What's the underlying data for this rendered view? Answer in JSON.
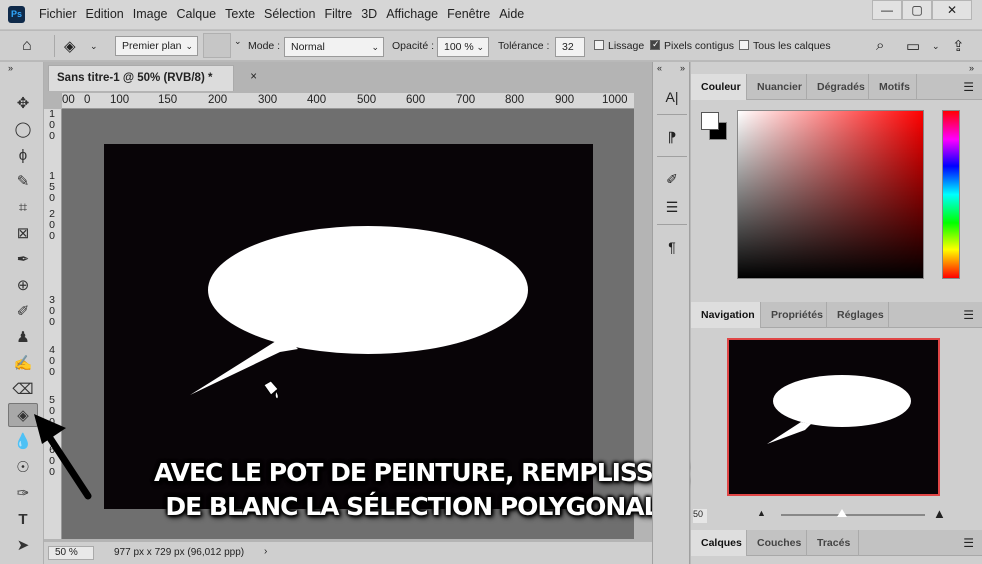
{
  "app": {
    "logo_text": "Ps"
  },
  "menu": [
    "Fichier",
    "Edition",
    "Image",
    "Calque",
    "Texte",
    "Sélection",
    "Filtre",
    "3D",
    "Affichage",
    "Fenêtre",
    "Aide"
  ],
  "window_controls": [
    "—",
    "▢",
    "✕"
  ],
  "options": {
    "fill_source": "Premier plan",
    "mode_label": "Mode :",
    "mode_value": "Normal",
    "opacity_label": "Opacité :",
    "opacity_value": "100 %",
    "tolerance_label": "Tolérance :",
    "tolerance_value": "32",
    "lissage_label": "Lissage",
    "lissage_checked": false,
    "contigus_label": "Pixels contigus",
    "contigus_checked": true,
    "tous_calques_label": "Tous les calques",
    "tous_calques_checked": false
  },
  "document": {
    "tab_title": "Sans titre-1 @ 50% (RVB/8) *",
    "tab_close": "×",
    "ruler_h": [
      "00",
      "0",
      "100",
      "150",
      "200",
      "300",
      "400",
      "500",
      "600",
      "700",
      "800",
      "900",
      "1000"
    ],
    "ruler_v": [
      "1\n0\n0",
      "1\n5\n0",
      "2\n0\n0",
      "3\n0\n0",
      "4\n0\n0",
      "5\n0\n0",
      "6\n0\n0"
    ],
    "status_zoom": "50 %",
    "status_info": "977 px x 729 px (96,012 ppp)",
    "status_arrow": "›"
  },
  "caption": {
    "line1": "AVEC LE POT DE PEINTURE, REMPLISSEZ",
    "line2": "DE BLANC LA SÉLECTION POLYGONALE"
  },
  "panels": {
    "color_tabs": [
      "Couleur",
      "Nuancier",
      "Dégradés",
      "Motifs"
    ],
    "nav_tabs": [
      "Navigation",
      "Propriétés",
      "Réglages"
    ],
    "layer_tabs": [
      "Calques",
      "Couches",
      "Tracés"
    ],
    "nav_zoom": "50"
  },
  "colors": {
    "foreground": "#ffffff",
    "background": "#000000",
    "nav_frame": "#e04646"
  }
}
